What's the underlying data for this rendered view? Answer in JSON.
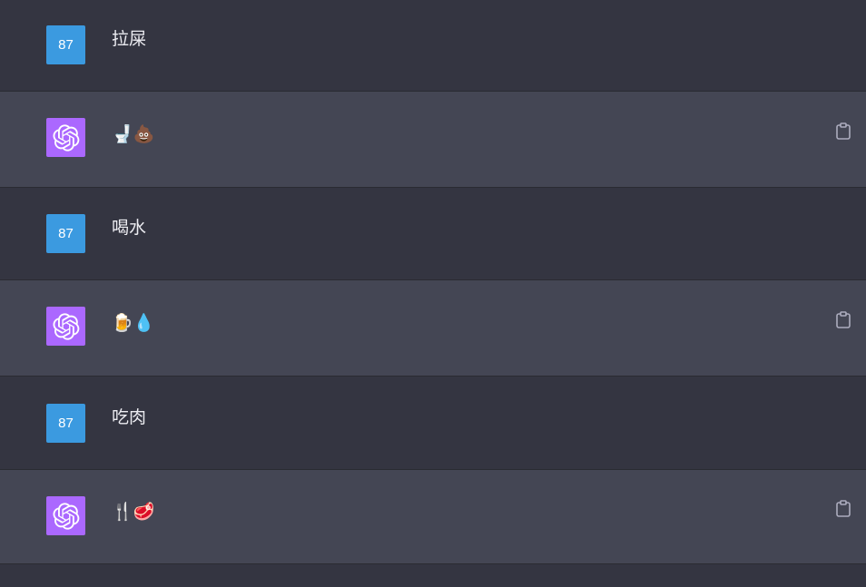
{
  "user_avatar_label": "87",
  "colors": {
    "user_bg": "#343541",
    "bot_bg": "#444654",
    "user_avatar": "#3b9ae0",
    "bot_avatar": "#ab68ff"
  },
  "messages": [
    {
      "role": "user",
      "text": "拉屎"
    },
    {
      "role": "assistant",
      "text": "🚽💩",
      "action_icon": "clipboard-icon"
    },
    {
      "role": "user",
      "text": "喝水"
    },
    {
      "role": "assistant",
      "text": "🍺💧",
      "action_icon": "clipboard-icon"
    },
    {
      "role": "user",
      "text": "吃肉"
    },
    {
      "role": "assistant",
      "text": "🍴🥩",
      "action_icon": "clipboard-icon"
    }
  ]
}
